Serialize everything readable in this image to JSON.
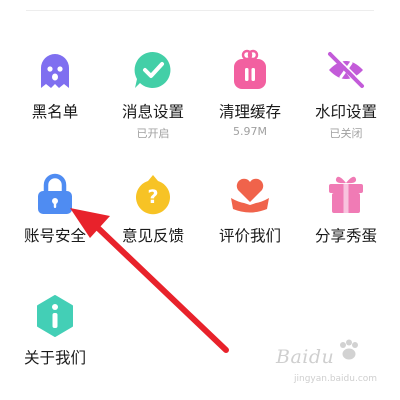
{
  "settings_grid": {
    "items": [
      {
        "label": "黑名单",
        "sub": "",
        "icon": "ghost-icon",
        "color": "#7f6ff0"
      },
      {
        "label": "消息设置",
        "sub": "已开启",
        "icon": "chat-check-icon",
        "color": "#43cfa7"
      },
      {
        "label": "清理缓存",
        "sub": "5.97M",
        "icon": "trash-bag-icon",
        "color": "#f260a0"
      },
      {
        "label": "水印设置",
        "sub": "已关闭",
        "icon": "watermark-icon",
        "color": "#c35bd9"
      },
      {
        "label": "账号安全",
        "sub": "",
        "icon": "lock-icon",
        "color": "#4f8cf2"
      },
      {
        "label": "意见反馈",
        "sub": "",
        "icon": "question-chick-icon",
        "color": "#f7c325"
      },
      {
        "label": "评价我们",
        "sub": "",
        "icon": "heart-hand-icon",
        "color": "#f0634b"
      },
      {
        "label": "分享秀蛋",
        "sub": "",
        "icon": "gift-icon",
        "color": "#f07bb5"
      },
      {
        "label": "关于我们",
        "sub": "",
        "icon": "info-hexagon-icon",
        "color": "#43cfb6"
      }
    ]
  },
  "annotation": {
    "arrow_color": "#e8222b",
    "arrow_icon": "red-arrow-icon"
  },
  "watermark": {
    "brand": "Baidu",
    "sub": "jingyan.baidu.com"
  }
}
